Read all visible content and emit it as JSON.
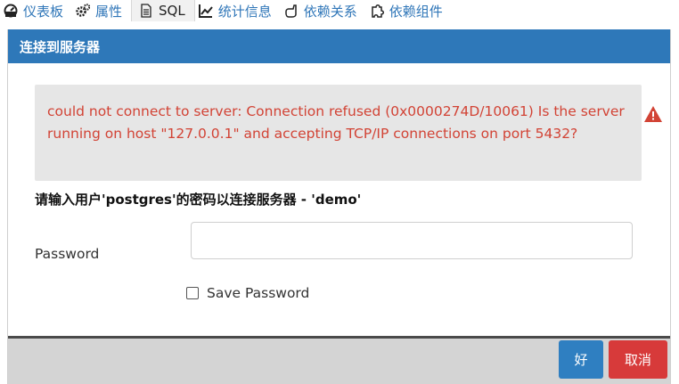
{
  "tabs": [
    {
      "label": "仪表板",
      "icon": "dashboard-icon",
      "active": false
    },
    {
      "label": "属性",
      "icon": "cogs-icon",
      "active": false
    },
    {
      "label": "SQL",
      "icon": "file-text-icon",
      "active": true
    },
    {
      "label": "统计信息",
      "icon": "line-chart-icon",
      "active": false
    },
    {
      "label": "依赖关系",
      "icon": "hand-pointer-icon",
      "active": false
    },
    {
      "label": "依赖组件",
      "icon": "puzzle-icon",
      "active": false
    }
  ],
  "dialog": {
    "title": "连接到服务器",
    "error_message": "could not connect to server: Connection refused (0x0000274D/10061) Is the server running on host \"127.0.0.1\" and accepting TCP/IP connections on port 5432?",
    "error_icon": "warning-triangle-icon",
    "prompt": "请输入用户'postgres'的密码以连接服务器 - 'demo'",
    "password_label": "Password",
    "password_value": "",
    "save_password_label": "Save Password",
    "save_password_checked": false,
    "ok_label": "好",
    "cancel_label": "取消"
  },
  "colors": {
    "header_bg": "#2e78b9",
    "error_text": "#d24335",
    "ok_button": "#2f7fc1",
    "cancel_button": "#d73a3a",
    "tab_text": "#2f76b8"
  }
}
